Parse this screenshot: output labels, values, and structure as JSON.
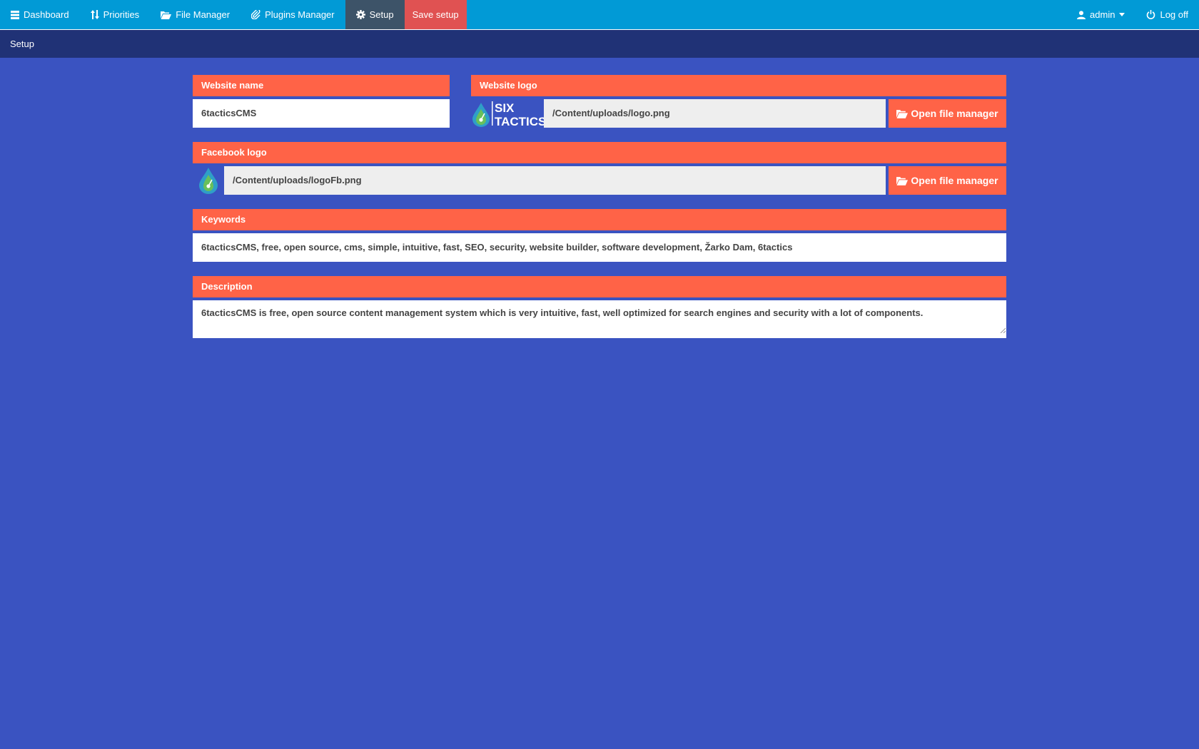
{
  "topbar": {
    "nav": [
      {
        "label": "Dashboard",
        "icon": "list-icon"
      },
      {
        "label": "Priorities",
        "icon": "sort-icon"
      },
      {
        "label": "File Manager",
        "icon": "folder-open-icon"
      },
      {
        "label": "Plugins Manager",
        "icon": "paperclip-icon"
      },
      {
        "label": "Setup",
        "icon": "gear-icon"
      },
      {
        "label": "Save setup"
      }
    ],
    "user": {
      "label": "admin",
      "icon": "user-icon"
    },
    "logoff": {
      "label": "Log off",
      "icon": "power-icon"
    }
  },
  "breadcrumb": {
    "title": "Setup"
  },
  "form": {
    "website_name": {
      "label": "Website name",
      "value": "6tacticsCMS"
    },
    "website_logo": {
      "label": "Website logo",
      "value": "/Content/uploads/logo.png",
      "button": "Open file manager",
      "logo_text_1": "SIX",
      "logo_text_2": "TACTICS"
    },
    "facebook_logo": {
      "label": "Facebook logo",
      "value": "/Content/uploads/logoFb.png",
      "button": "Open file manager"
    },
    "keywords": {
      "label": "Keywords",
      "value": "6tacticsCMS, free, open source, cms, simple, intuitive, fast, SEO, security, website builder, software development, Žarko Dam, 6tactics"
    },
    "description": {
      "label": "Description",
      "value": "6tacticsCMS is free, open source content management system which is very intuitive, fast, well optimized for search engines and security with a lot of components."
    }
  },
  "colors": {
    "topbar": "#019ad6",
    "subbar": "#203276",
    "background": "#3a53c1",
    "accent": "#ff6347",
    "save": "#e05252",
    "active_tab": "#3d5368"
  }
}
